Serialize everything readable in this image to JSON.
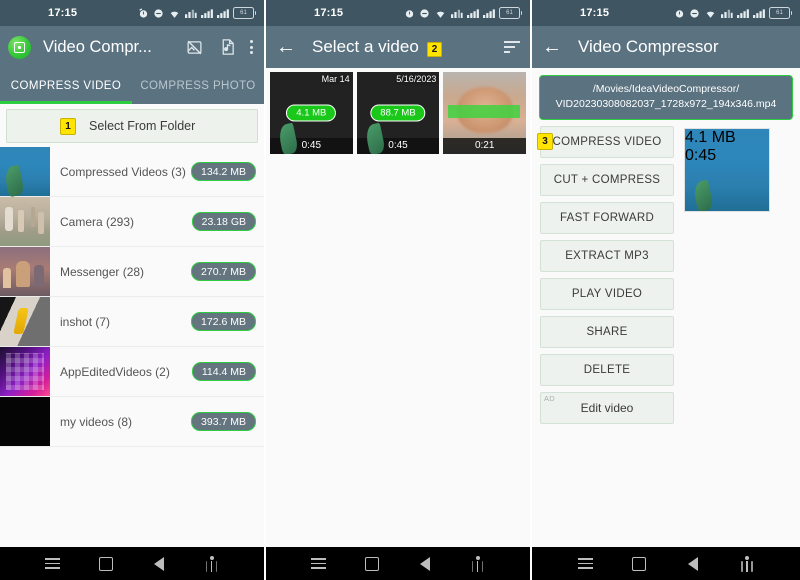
{
  "status_bar": {
    "time": "17:15",
    "battery_level": "61",
    "icons": [
      "alarm-icon",
      "dnd-icon",
      "wifi-icon",
      "mobile-data-icon",
      "signal-1-icon",
      "signal-2-icon",
      "battery-icon"
    ]
  },
  "colors": {
    "appbar": "#5b7280",
    "statusbar": "#3f5561",
    "accent_green": "#2ecc40",
    "badge_yellow": "#ffe400",
    "page_bg": "#fafafa"
  },
  "screen1": {
    "app_title": "Video Compr...",
    "logo_icon": "app-logo-icon",
    "actions": [
      {
        "name": "image-off-icon",
        "label": ""
      },
      {
        "name": "audio-file-icon",
        "label": ""
      },
      {
        "name": "overflow-menu-icon",
        "label": ""
      }
    ],
    "tabs": [
      {
        "label": "COMPRESS VIDEO",
        "active": true
      },
      {
        "label": "COMPRESS PHOTO",
        "active": false
      }
    ],
    "select_folder": {
      "label": "Select From Folder",
      "marker": "1"
    },
    "folders": [
      {
        "name": "Compressed Videos (3)",
        "size": "134.2 MB",
        "thumb": "t-ocean"
      },
      {
        "name": "Camera (293)",
        "size": "23.18 GB",
        "thumb": "t-crowd"
      },
      {
        "name": "Messenger (28)",
        "size": "270.7 MB",
        "thumb": "t-party"
      },
      {
        "name": "inshot (7)",
        "size": "172.6 MB",
        "thumb": "t-inshot"
      },
      {
        "name": "AppEditedVideos (2)",
        "size": "114.4 MB",
        "thumb": "t-keyboard"
      },
      {
        "name": "my videos (8)",
        "size": "393.7 MB",
        "thumb": "t-black"
      }
    ]
  },
  "screen2": {
    "back_icon": "back-arrow-icon",
    "title": "Select a video",
    "marker": "2",
    "sort_icon": "sort-icon",
    "videos": [
      {
        "date": "Mar 14",
        "size": "4.1 MB",
        "duration": "0:45",
        "thumb": "t-ocean"
      },
      {
        "date": "5/16/2023",
        "size": "88.7 MB",
        "duration": "0:45",
        "thumb": "t-ocean"
      },
      {
        "date": "",
        "size": "",
        "duration": "0:21",
        "thumb": "t-face"
      }
    ]
  },
  "screen3": {
    "back_icon": "back-arrow-icon",
    "title": "Video Compressor",
    "file_path_line1": "/Movies/IdeaVideoCompressor/",
    "file_path_line2": "VID20230308082037_1728x972_194x346.mp4",
    "marker": "3",
    "buttons": [
      {
        "label": "COMPRESS VIDEO",
        "ad": false
      },
      {
        "label": "CUT + COMPRESS",
        "ad": false
      },
      {
        "label": "FAST FORWARD",
        "ad": false
      },
      {
        "label": "EXTRACT MP3",
        "ad": false
      },
      {
        "label": "PLAY VIDEO",
        "ad": false
      },
      {
        "label": "SHARE",
        "ad": false
      },
      {
        "label": "DELETE",
        "ad": false
      },
      {
        "label": "Edit video",
        "ad": true,
        "ad_tag": "AD"
      }
    ],
    "preview": {
      "size": "4.1 MB",
      "duration": "0:45",
      "thumb": "t-ocean"
    }
  },
  "nav_bar": {
    "buttons": [
      "recents-icon",
      "home-icon",
      "back-icon",
      "accessibility-icon"
    ]
  }
}
